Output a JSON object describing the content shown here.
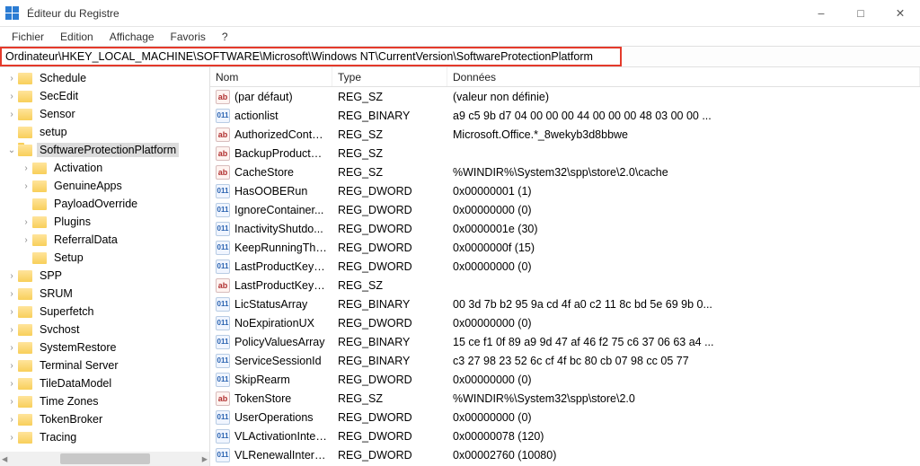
{
  "window": {
    "title": "Éditeur du Registre"
  },
  "menu": {
    "file": "Fichier",
    "edit": "Edition",
    "view": "Affichage",
    "favorites": "Favoris",
    "help": "?"
  },
  "address": "Ordinateur\\HKEY_LOCAL_MACHINE\\SOFTWARE\\Microsoft\\Windows NT\\CurrentVersion\\SoftwareProtectionPlatform",
  "tree": [
    {
      "label": "Schedule",
      "depth": 1,
      "chev": ">"
    },
    {
      "label": "SecEdit",
      "depth": 1,
      "chev": ">"
    },
    {
      "label": "Sensor",
      "depth": 1,
      "chev": ">"
    },
    {
      "label": "setup",
      "depth": 1,
      "chev": ""
    },
    {
      "label": "SoftwareProtectionPlatform",
      "depth": 1,
      "chev": "v",
      "open": true,
      "selected": true
    },
    {
      "label": "Activation",
      "depth": 2,
      "chev": ">"
    },
    {
      "label": "GenuineApps",
      "depth": 2,
      "chev": ">"
    },
    {
      "label": "PayloadOverride",
      "depth": 2,
      "chev": ""
    },
    {
      "label": "Plugins",
      "depth": 2,
      "chev": ">"
    },
    {
      "label": "ReferralData",
      "depth": 2,
      "chev": ">"
    },
    {
      "label": "Setup",
      "depth": 2,
      "chev": ""
    },
    {
      "label": "SPP",
      "depth": 1,
      "chev": ">"
    },
    {
      "label": "SRUM",
      "depth": 1,
      "chev": ">"
    },
    {
      "label": "Superfetch",
      "depth": 1,
      "chev": ">"
    },
    {
      "label": "Svchost",
      "depth": 1,
      "chev": ">"
    },
    {
      "label": "SystemRestore",
      "depth": 1,
      "chev": ">"
    },
    {
      "label": "Terminal Server",
      "depth": 1,
      "chev": ">"
    },
    {
      "label": "TileDataModel",
      "depth": 1,
      "chev": ">"
    },
    {
      "label": "Time Zones",
      "depth": 1,
      "chev": ">"
    },
    {
      "label": "TokenBroker",
      "depth": 1,
      "chev": ">"
    },
    {
      "label": "Tracing",
      "depth": 1,
      "chev": ">"
    }
  ],
  "columns": {
    "name": "Nom",
    "type": "Type",
    "data": "Données"
  },
  "values": [
    {
      "name": "(par défaut)",
      "type": "REG_SZ",
      "data": "(valeur non définie)",
      "icon": "string"
    },
    {
      "name": "actionlist",
      "type": "REG_BINARY",
      "data": "a9 c5 9b d7 04 00 00 00 44 00 00 00 48 03 00 00 ...",
      "icon": "binary"
    },
    {
      "name": "AuthorizedConta...",
      "type": "REG_SZ",
      "data": "Microsoft.Office.*_8wekyb3d8bbwe",
      "icon": "string"
    },
    {
      "name": "BackupProductK...",
      "type": "REG_SZ",
      "data": " ",
      "icon": "string",
      "selected": true
    },
    {
      "name": "CacheStore",
      "type": "REG_SZ",
      "data": "%WINDIR%\\System32\\spp\\store\\2.0\\cache",
      "icon": "string"
    },
    {
      "name": "HasOOBERun",
      "type": "REG_DWORD",
      "data": "0x00000001 (1)",
      "icon": "binary"
    },
    {
      "name": "IgnoreContainer...",
      "type": "REG_DWORD",
      "data": "0x00000000 (0)",
      "icon": "binary"
    },
    {
      "name": "InactivityShutdo...",
      "type": "REG_DWORD",
      "data": "0x0000001e (30)",
      "icon": "binary"
    },
    {
      "name": "KeepRunningThr...",
      "type": "REG_DWORD",
      "data": "0x0000000f (15)",
      "icon": "binary"
    },
    {
      "name": "LastProductKeyEr...",
      "type": "REG_DWORD",
      "data": "0x00000000 (0)",
      "icon": "binary"
    },
    {
      "name": "LastProductKeyPid",
      "type": "REG_SZ",
      "data": "",
      "icon": "string"
    },
    {
      "name": "LicStatusArray",
      "type": "REG_BINARY",
      "data": "00 3d 7b b2 95 9a cd 4f a0 c2 11 8c bd 5e 69 9b 0...",
      "icon": "binary"
    },
    {
      "name": "NoExpirationUX",
      "type": "REG_DWORD",
      "data": "0x00000000 (0)",
      "icon": "binary"
    },
    {
      "name": "PolicyValuesArray",
      "type": "REG_BINARY",
      "data": "15 ce f1 0f 89 a9 9d 47 af 46 f2 75 c6 37 06 63 a4 ...",
      "icon": "binary"
    },
    {
      "name": "ServiceSessionId",
      "type": "REG_BINARY",
      "data": "c3 27 98 23 52 6c cf 4f bc 80 cb 07 98 cc 05 77",
      "icon": "binary"
    },
    {
      "name": "SkipRearm",
      "type": "REG_DWORD",
      "data": "0x00000000 (0)",
      "icon": "binary"
    },
    {
      "name": "TokenStore",
      "type": "REG_SZ",
      "data": "%WINDIR%\\System32\\spp\\store\\2.0",
      "icon": "string"
    },
    {
      "name": "UserOperations",
      "type": "REG_DWORD",
      "data": "0x00000000 (0)",
      "icon": "binary"
    },
    {
      "name": "VLActivationInter...",
      "type": "REG_DWORD",
      "data": "0x00000078 (120)",
      "icon": "binary"
    },
    {
      "name": "VLRenewalInterval",
      "type": "REG_DWORD",
      "data": "0x00002760 (10080)",
      "icon": "binary"
    }
  ]
}
